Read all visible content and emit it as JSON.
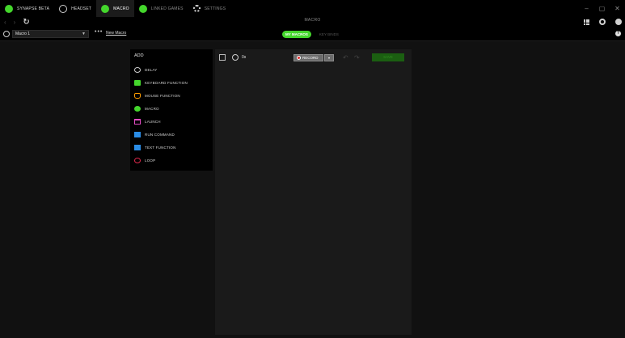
{
  "titlebar": {
    "tabs": [
      {
        "label": "SYNAPSE BETA",
        "icon": "razer-logo-icon"
      },
      {
        "label": "HEADSET",
        "icon": "headset-icon"
      },
      {
        "label": "MACRO",
        "icon": "macro-icon",
        "active": true
      },
      {
        "label": "LINKED GAMES",
        "icon": "link-icon"
      },
      {
        "label": "SETTINGS",
        "icon": "gear-icon"
      }
    ],
    "window_controls": {
      "minimize": "–",
      "maximize": "▢",
      "close": "✕"
    }
  },
  "nav": {
    "back": "‹",
    "forward": "›",
    "refresh": "↻",
    "page_title": "MACRO"
  },
  "toolbar": {
    "macro_select_value": "Macro 1",
    "more": "•••",
    "new_macro": "New Macro",
    "tabs": [
      {
        "label": "MY MACROS",
        "active": true
      },
      {
        "label": "KEY BINDS",
        "active": false
      }
    ],
    "help": "?"
  },
  "add_panel": {
    "title": "ADD",
    "items": [
      {
        "label": "DELAY",
        "icon": "clock-icon"
      },
      {
        "label": "KEYBOARD FUNCTION",
        "icon": "keyboard-icon"
      },
      {
        "label": "MOUSE FUNCTION",
        "icon": "mouse-icon"
      },
      {
        "label": "MACRO",
        "icon": "macro-icon"
      },
      {
        "label": "LAUNCH",
        "icon": "launch-icon"
      },
      {
        "label": "RUN COMMAND",
        "icon": "terminal-icon"
      },
      {
        "label": "TEXT FUNCTION",
        "icon": "text-icon"
      },
      {
        "label": "LOOP",
        "icon": "loop-icon"
      }
    ]
  },
  "editor": {
    "duration": "0s",
    "record_label": "RECORD",
    "record_dropdown": "▾",
    "undo": "↶",
    "redo": "↷",
    "save_label": "SAVE"
  },
  "colors": {
    "accent": "#44d62c",
    "background": "#111111",
    "panel": "#1a1a1a"
  }
}
